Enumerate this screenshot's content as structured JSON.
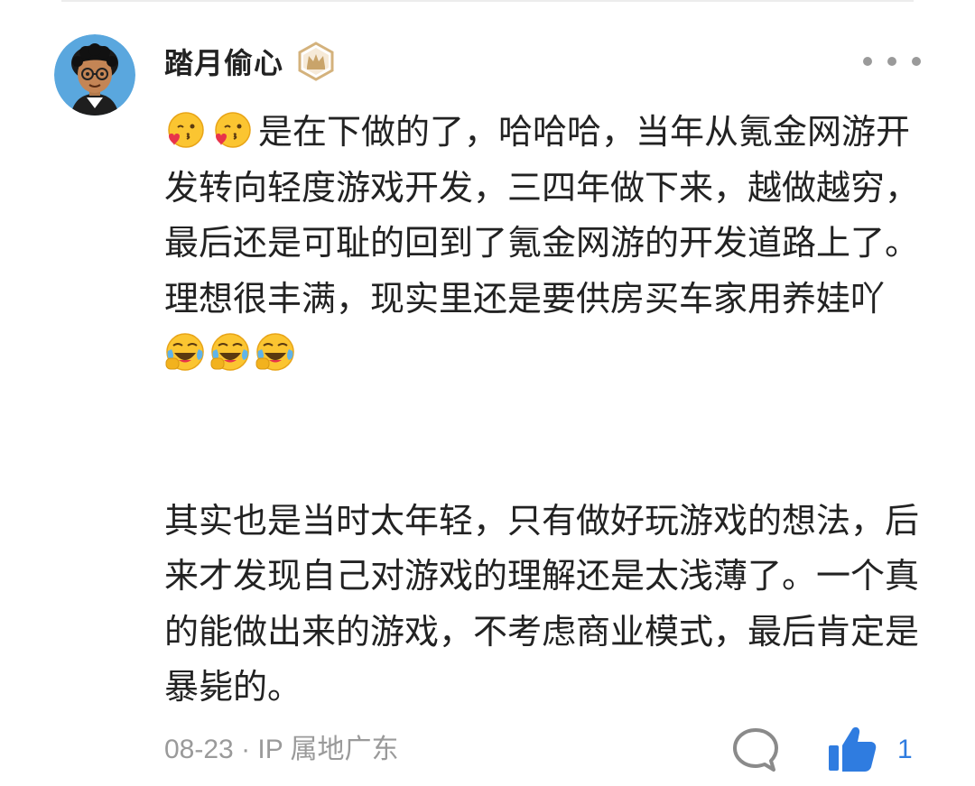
{
  "comment": {
    "author": {
      "name": "踏月偷心",
      "avatar_icon": "cartoon-avatar-glasses",
      "badge_icon": "crown-badge-icon",
      "badge_color": "#c9a46a"
    },
    "paragraphs": [
      {
        "leading_emojis": [
          "kiss-emoji",
          "kiss-emoji"
        ],
        "text": "是在下做的了，哈哈哈，当年从氪金网游开发转向轻度游戏开发，三四年做下来，越做越穷，最后还是可耻的回到了氪金网游的开发道路上了。理想很丰满，现实里还是要供房买车家用养娃吖",
        "trailing_emojis": [
          "facepalm-laugh-emoji",
          "facepalm-laugh-emoji",
          "facepalm-laugh-emoji"
        ]
      },
      {
        "text": "其实也是当时太年轻，只有做好玩游戏的想法，后来才发现自己对游戏的理解还是太浅薄了。一个真的能做出来的游戏，不考虑商业模式，最后肯定是暴毙的。"
      }
    ],
    "meta": "08-23 · IP 属地广东",
    "actions": {
      "comment_icon": "comment-bubble-icon",
      "like_icon": "thumbs-up-icon",
      "like_count": "1",
      "like_color": "#2f7ce0",
      "more_icon": "more-dots-icon"
    }
  }
}
